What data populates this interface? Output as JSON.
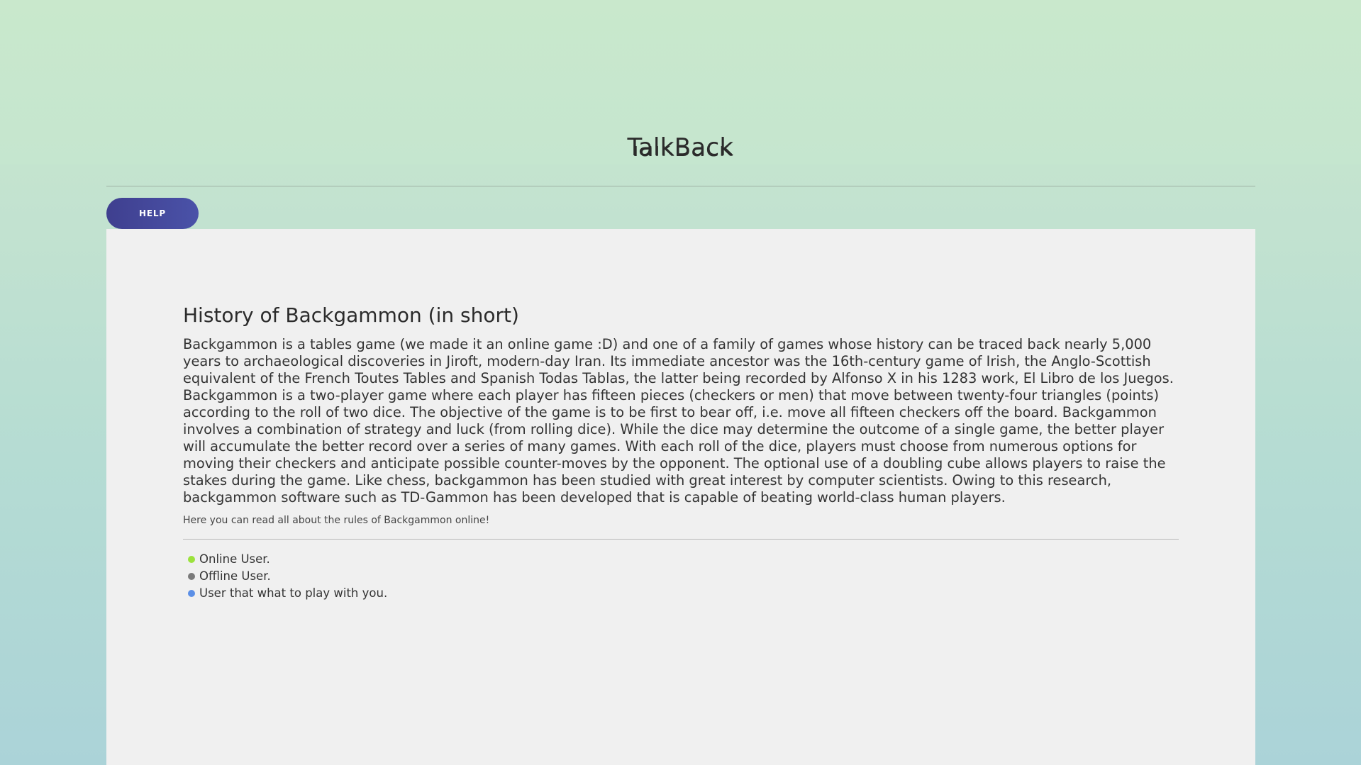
{
  "header": {
    "title": "TalkBack"
  },
  "toolbar": {
    "help_label": "HELP"
  },
  "main": {
    "section_title": "History of Backgammon (in short)",
    "history_text": "Backgammon is a tables game (we made it an online game :D) and one of a family of games whose history can be traced back nearly 5,000 years to archaeological discoveries in Jiroft, modern-day Iran. Its immediate ancestor was the 16th-century game of Irish, the Anglo-Scottish equivalent of the French Toutes Tables and Spanish Todas Tablas, the latter being recorded by Alfonso X in his 1283 work, El Libro de los Juegos. Backgammon is a two-player game where each player has fifteen pieces (checkers or men) that move between twenty-four triangles (points) according to the roll of two dice. The objective of the game is to be first to bear off, i.e. move all fifteen checkers off the board. Backgammon involves a combination of strategy and luck (from rolling dice). While the dice may determine the outcome of a single game, the better player will accumulate the better record over a series of many games. With each roll of the dice, players must choose from numerous options for moving their checkers and anticipate possible counter-moves by the opponent. The optional use of a doubling cube allows players to raise the stakes during the game. Like chess, backgammon has been studied with great interest by computer scientists. Owing to this research, backgammon software such as TD-Gammon has been developed that is capable of beating world-class human players.",
    "rules_note": "Here you can read all about the rules of Backgammon online!"
  },
  "legend": [
    {
      "label": "Online User.",
      "color": "#9be23c"
    },
    {
      "label": "Offline User.",
      "color": "#7a7a7a"
    },
    {
      "label": "User that what to play with you.",
      "color": "#5b8fe6"
    }
  ],
  "colors": {
    "help_button": "#4448a0",
    "panel": "#f0f0f0"
  }
}
